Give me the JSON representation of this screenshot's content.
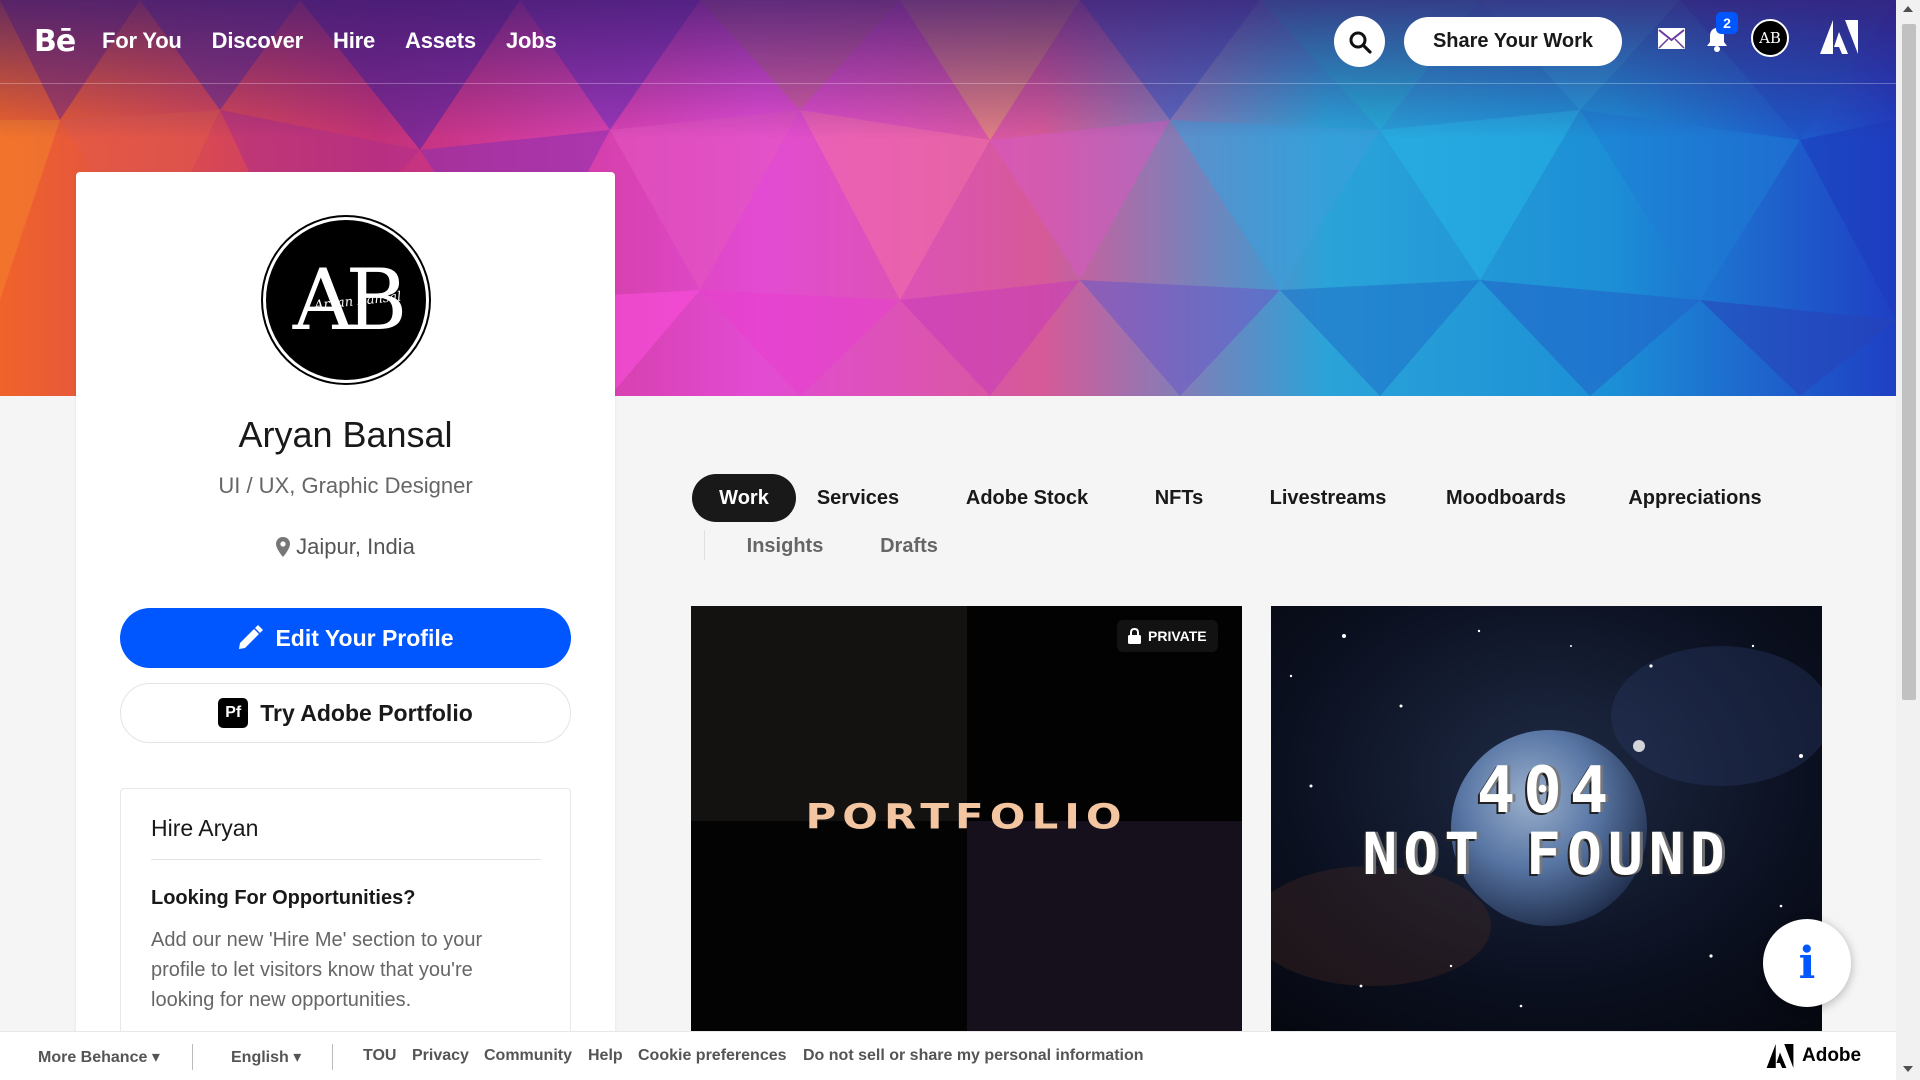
{
  "nav": {
    "logo": "Bē",
    "links": [
      "For You",
      "Discover",
      "Hire",
      "Assets",
      "Jobs"
    ],
    "share_label": "Share Your Work",
    "notification_count": "2",
    "avatar_initials": "AB"
  },
  "profile": {
    "avatar_initials": "AB",
    "avatar_script": "Aryan Bansal",
    "name": "Aryan Bansal",
    "role": "UI / UX, Graphic Designer",
    "location": "Jaipur, India",
    "edit_label": "Edit Your Profile",
    "portfolio_icon": "Pf",
    "portfolio_label": "Try Adobe Portfolio"
  },
  "hire": {
    "title": "Hire Aryan",
    "subtitle": "Looking For Opportunities?",
    "description": "Add our new 'Hire Me' section to your profile to let visitors know that you're looking for new opportunities."
  },
  "tabs": {
    "row1": [
      "Work",
      "Services",
      "Adobe Stock",
      "NFTs",
      "Livestreams",
      "Moodboards",
      "Appreciations"
    ],
    "row2": [
      "Insights",
      "Drafts"
    ],
    "active": "Work"
  },
  "projects": {
    "portfolio": {
      "badge": "PRIVATE",
      "cover_text": "PORTFOLIO"
    },
    "not_found": {
      "line1": "404",
      "line2": "NOT FOUND"
    }
  },
  "info_button": "i",
  "footer": {
    "more_behance": "More Behance",
    "language": "English",
    "links": [
      "TOU",
      "Privacy",
      "Community",
      "Help",
      "Cookie preferences",
      "Do not sell or share my personal information"
    ],
    "adobe": "Adobe"
  },
  "colors": {
    "accent": "#0057ff",
    "dark": "#191919",
    "portfolio_text": "#f3c6a1"
  },
  "icons": {
    "search": "search-icon",
    "mail": "mail-icon",
    "bell": "bell-icon",
    "pencil": "pencil-icon",
    "location": "location-pin-icon",
    "lock": "lock-icon",
    "adobe": "adobe-logo-icon"
  }
}
